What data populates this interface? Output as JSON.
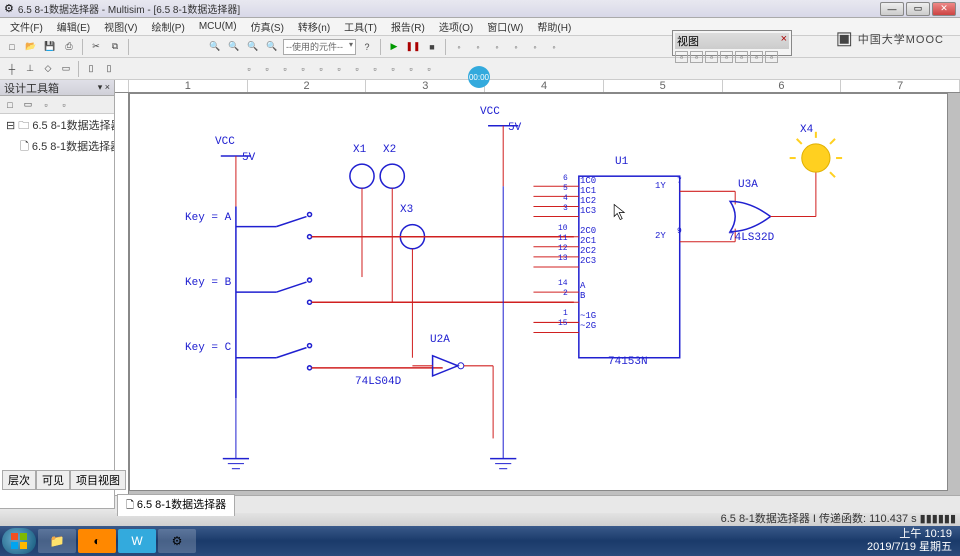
{
  "window": {
    "title": "6.5 8-1数据选择器 - Multisim - [6.5 8-1数据选择器]"
  },
  "menu": {
    "file": "文件(F)",
    "edit": "编辑(E)",
    "view": "视图(V)",
    "draw": "绘制(P)",
    "mcu": "MCU(M)",
    "sim": "仿真(S)",
    "transfer": "转移(n)",
    "tools": "工具(T)",
    "report": "报告(R)",
    "options": "选项(O)",
    "window": "窗口(W)",
    "help": "帮助(H)"
  },
  "toolbar": {
    "component_combo": "--使用的元件--",
    "play": "▶",
    "pause": "❚❚",
    "stop": "■"
  },
  "float_panel": {
    "title": "视图"
  },
  "sidebar": {
    "title": "设计工具箱",
    "root": "6.5 8-1数据选择器",
    "child": "6.5 8-1数据选择器",
    "tabs": [
      "层次",
      "可见",
      "项目视图"
    ]
  },
  "ruler": [
    "1",
    "2",
    "3",
    "4",
    "5",
    "6",
    "7"
  ],
  "schematic": {
    "vcc1": "VCC",
    "v1": "5V",
    "vcc2": "VCC",
    "v2": "5V",
    "x1": "X1",
    "x2": "X2",
    "x3": "X3",
    "x4": "X4",
    "u1": "U1",
    "u2a": "U2A",
    "u3a": "U3A",
    "keyA": "Key = A",
    "keyB": "Key = B",
    "keyC": "Key = C",
    "chip": "74153N",
    "inv": "74LS04D",
    "or": "74LS32D",
    "pins": {
      "1c0": "1C0",
      "1c1": "1C1",
      "1c2": "1C2",
      "1c3": "1C3",
      "2c0": "2C0",
      "2c1": "2C1",
      "2c2": "2C2",
      "2c3": "2C3",
      "a": "A",
      "b": "B",
      "1g": "~1G",
      "2g": "~2G",
      "1y": "1Y",
      "2y": "2Y"
    },
    "pin_nums": {
      "6": "6",
      "5": "5",
      "4": "4",
      "3": "3",
      "10": "10",
      "11": "11",
      "12": "12",
      "13": "13",
      "14": "14",
      "2": "2",
      "1": "1",
      "15": "15",
      "7": "7",
      "9": "9"
    }
  },
  "bottom_tab": "6.5 8-1数据选择器",
  "status": {
    "left": "",
    "right": "6.5 8-1数据选择器  I  传递函数: 110.437 s  ▮▮▮▮▮▮"
  },
  "taskbar": {
    "time": "上午 10:19",
    "date": "2019/7/19 星期五"
  },
  "watermark": "中国大学MOOC",
  "bubble": "00:00"
}
